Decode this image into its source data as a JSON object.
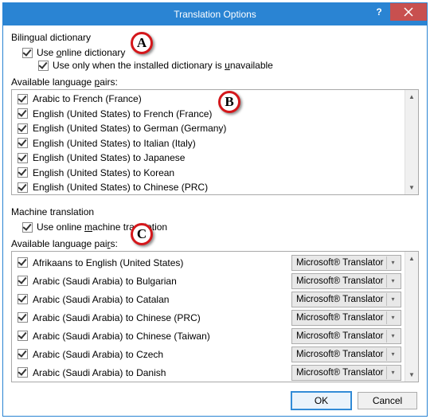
{
  "window": {
    "title": "Translation Options"
  },
  "badges": {
    "a": "A",
    "b": "B",
    "c": "C"
  },
  "bilingual": {
    "section": "Bilingual dictionary",
    "use_online_pre": "Use ",
    "use_online_u": "o",
    "use_online_post": "nline dictionary",
    "use_only_pre": "Use only when the installed dictionary is ",
    "use_only_u": "u",
    "use_only_post": "navailable",
    "pairs_pre": "Available language ",
    "pairs_u": "p",
    "pairs_post": "airs:",
    "items": [
      "Arabic to French (France)",
      "English (United States) to French (France)",
      "English (United States) to German (Germany)",
      "English (United States) to Italian (Italy)",
      "English (United States) to Japanese",
      "English (United States) to Korean",
      "English (United States) to Chinese (PRC)"
    ]
  },
  "mt": {
    "section": "Machine translation",
    "use_online_pre": "Use online ",
    "use_online_u": "m",
    "use_online_post": "achine translation",
    "pairs_pre": "Available language pai",
    "pairs_u": "r",
    "pairs_post": "s:",
    "provider": "Microsoft® Translator",
    "items": [
      "Afrikaans to English (United States)",
      "Arabic (Saudi Arabia) to Bulgarian",
      "Arabic (Saudi Arabia) to Catalan",
      "Arabic (Saudi Arabia) to Chinese (PRC)",
      "Arabic (Saudi Arabia) to Chinese (Taiwan)",
      "Arabic (Saudi Arabia) to Czech",
      "Arabic (Saudi Arabia) to Danish"
    ]
  },
  "buttons": {
    "ok": "OK",
    "cancel": "Cancel"
  }
}
